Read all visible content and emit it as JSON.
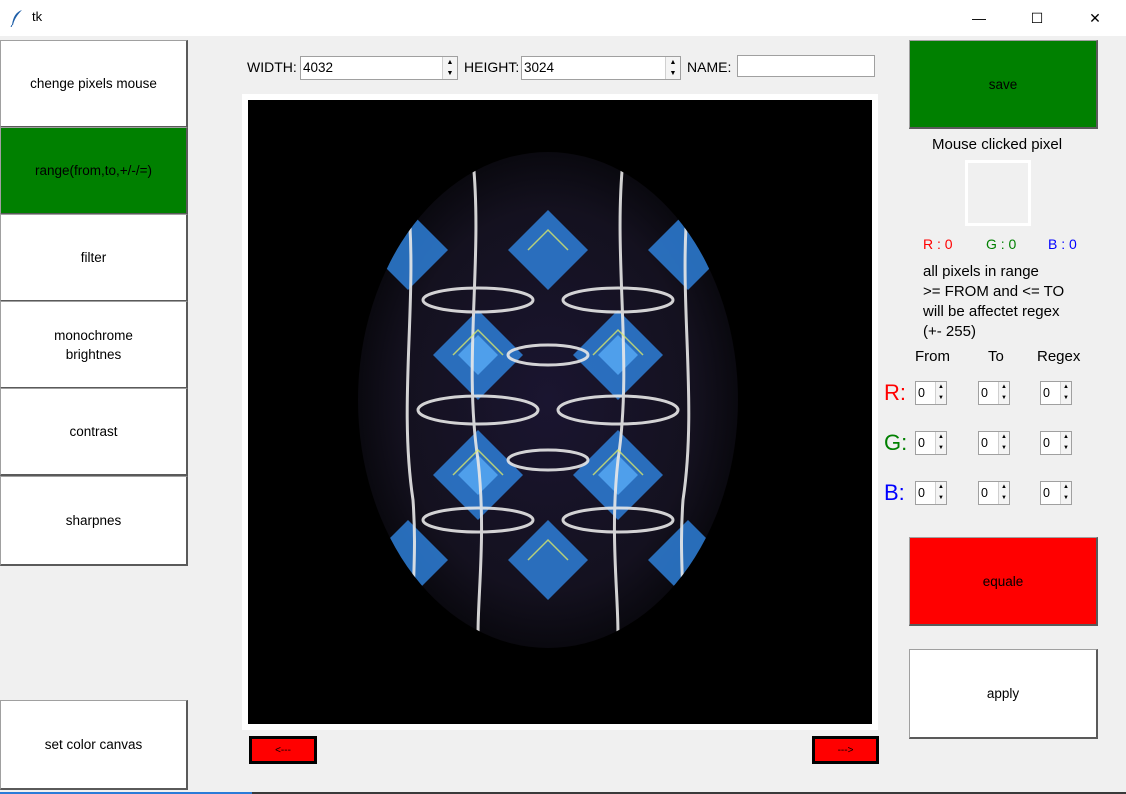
{
  "window": {
    "title": "tk",
    "minimize": "—",
    "maximize": "☐",
    "close": "✕"
  },
  "sidebar": {
    "buttons": [
      {
        "label": "chenge pixels mouse",
        "active": false
      },
      {
        "label": "range(from,to,+/-/=)",
        "active": true
      },
      {
        "label": "filter",
        "active": false
      },
      {
        "label": "monochrome\nbrightnes",
        "active": false
      },
      {
        "label": "contrast",
        "active": false
      },
      {
        "label": "sharpnes",
        "active": false
      }
    ],
    "set_color_label": "set color canvas"
  },
  "toolbar": {
    "width_label": "WIDTH:",
    "width_value": "4032",
    "height_label": "HEIGHT:",
    "height_value": "3024",
    "name_label": "NAME:",
    "name_value": ""
  },
  "nav": {
    "prev_label": "<---",
    "next_label": "--->"
  },
  "right": {
    "save_label": "save",
    "pixel_title": "Mouse clicked pixel",
    "r_text": "R : 0",
    "g_text": "G : 0",
    "b_text": "B : 0",
    "info_lines": [
      "all pixels in range",
      ">= FROM and <= TO",
      "will be affectet regex",
      "(+- 255)"
    ],
    "headers": {
      "from": "From",
      "to": "To",
      "regex": "Regex"
    },
    "rows": [
      {
        "label": "R:",
        "from": "0",
        "to": "0",
        "regex": "0"
      },
      {
        "label": "G:",
        "from": "0",
        "to": "0",
        "regex": "0"
      },
      {
        "label": "B:",
        "from": "0",
        "to": "0",
        "regex": "0"
      }
    ],
    "equale_label": "equale",
    "apply_label": "apply"
  },
  "colors": {
    "active_green": "#008000",
    "red": "#ff0000",
    "r_color": "#ff0000",
    "g_color": "#008000",
    "b_color": "#0000ff"
  },
  "icons": {
    "app": "feather-icon",
    "spin_up": "▲",
    "spin_down": "▼"
  }
}
